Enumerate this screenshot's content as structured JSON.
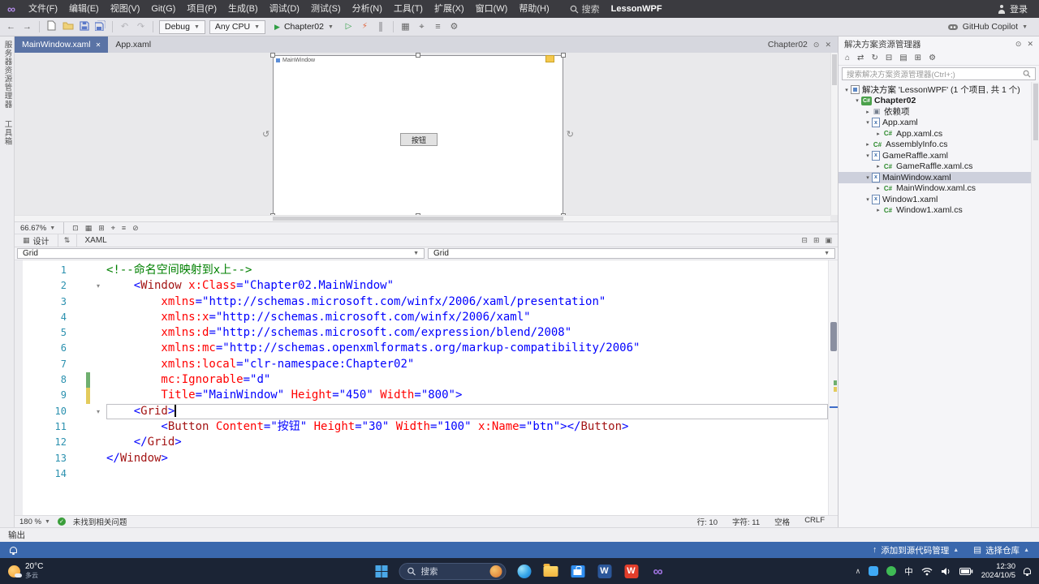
{
  "title_bar": {
    "menus": [
      "文件(F)",
      "编辑(E)",
      "视图(V)",
      "Git(G)",
      "项目(P)",
      "生成(B)",
      "调试(D)",
      "测试(S)",
      "分析(N)",
      "工具(T)",
      "扩展(X)",
      "窗口(W)",
      "帮助(H)"
    ],
    "search_label": "搜索",
    "solution_name": "LessonWPF",
    "sign_in_label": "登录"
  },
  "toolbar": {
    "debug_config": "Debug",
    "platform": "Any CPU",
    "run_target": "Chapter02",
    "copilot_label": "GitHub Copilot"
  },
  "left_rail": {
    "items": [
      "服务器资源管理器",
      "工具箱"
    ]
  },
  "doc_tabs": {
    "tabs": [
      {
        "label": "MainWindow.xaml",
        "active": true,
        "closable": true
      },
      {
        "label": "App.xaml",
        "active": false,
        "closable": false
      }
    ],
    "group_label": "Chapter02"
  },
  "designer": {
    "window_title": "MainWindow",
    "button_label": "按钮",
    "zoom": "66.67%"
  },
  "view_switch": {
    "design_label": "设计",
    "xaml_label": "XAML"
  },
  "nav_bar": {
    "left_dropdown": "Grid",
    "right_dropdown": "Grid"
  },
  "editor": {
    "status": {
      "zoom": "180 %",
      "health": "未找到相关问题",
      "line": "行: 10",
      "column": "字符: 11",
      "spaces": "空格",
      "line_ending": "CRLF"
    },
    "lines": [
      {
        "n": 1,
        "indent": 0,
        "tokens": [
          {
            "c": "c",
            "x": "<!--命名空间映射到x上-->"
          }
        ]
      },
      {
        "n": 2,
        "indent": 4,
        "fold": true,
        "tokens": [
          {
            "c": "d",
            "x": "<"
          },
          {
            "c": "e",
            "x": "Window"
          },
          {
            "c": "p",
            "x": " "
          },
          {
            "c": "a",
            "x": "x:Class"
          },
          {
            "c": "d",
            "x": "="
          },
          {
            "c": "v",
            "x": "\"Chapter02.MainWindow\""
          }
        ]
      },
      {
        "n": 3,
        "indent": 8,
        "tokens": [
          {
            "c": "a",
            "x": "xmlns"
          },
          {
            "c": "d",
            "x": "="
          },
          {
            "c": "v",
            "x": "\"http://schemas.microsoft.com/winfx/2006/xaml/presentation\""
          }
        ]
      },
      {
        "n": 4,
        "indent": 8,
        "tokens": [
          {
            "c": "a",
            "x": "xmlns:x"
          },
          {
            "c": "d",
            "x": "="
          },
          {
            "c": "v",
            "x": "\"http://schemas.microsoft.com/winfx/2006/xaml\""
          }
        ]
      },
      {
        "n": 5,
        "indent": 8,
        "tokens": [
          {
            "c": "a",
            "x": "xmlns:d"
          },
          {
            "c": "d",
            "x": "="
          },
          {
            "c": "v",
            "x": "\"http://schemas.microsoft.com/expression/blend/2008\""
          }
        ]
      },
      {
        "n": 6,
        "indent": 8,
        "tokens": [
          {
            "c": "a",
            "x": "xmlns:mc"
          },
          {
            "c": "d",
            "x": "="
          },
          {
            "c": "v",
            "x": "\"http://schemas.openxmlformats.org/markup-compatibility/2006\""
          }
        ]
      },
      {
        "n": 7,
        "indent": 8,
        "tokens": [
          {
            "c": "a",
            "x": "xmlns:local"
          },
          {
            "c": "d",
            "x": "="
          },
          {
            "c": "v",
            "x": "\"clr-namespace:Chapter02\""
          }
        ]
      },
      {
        "n": 8,
        "indent": 8,
        "track": "green",
        "tokens": [
          {
            "c": "a",
            "x": "mc:Ignorable"
          },
          {
            "c": "d",
            "x": "="
          },
          {
            "c": "v",
            "x": "\"d\""
          }
        ]
      },
      {
        "n": 9,
        "indent": 8,
        "track": "yellow",
        "tokens": [
          {
            "c": "a",
            "x": "Title"
          },
          {
            "c": "d",
            "x": "="
          },
          {
            "c": "v",
            "x": "\"MainWindow\""
          },
          {
            "c": "p",
            "x": " "
          },
          {
            "c": "a",
            "x": "Height"
          },
          {
            "c": "d",
            "x": "="
          },
          {
            "c": "v",
            "x": "\"450\""
          },
          {
            "c": "p",
            "x": " "
          },
          {
            "c": "a",
            "x": "Width"
          },
          {
            "c": "d",
            "x": "="
          },
          {
            "c": "v",
            "x": "\"800\""
          },
          {
            "c": "d",
            "x": ">"
          }
        ]
      },
      {
        "n": 10,
        "indent": 4,
        "fold": true,
        "current": true,
        "caret": true,
        "tokens": [
          {
            "c": "d",
            "x": "<"
          },
          {
            "c": "e",
            "x": "Grid"
          },
          {
            "c": "d",
            "x": ">"
          }
        ]
      },
      {
        "n": 11,
        "indent": 8,
        "tokens": [
          {
            "c": "d",
            "x": "<"
          },
          {
            "c": "e",
            "x": "Button"
          },
          {
            "c": "p",
            "x": " "
          },
          {
            "c": "a",
            "x": "Content"
          },
          {
            "c": "d",
            "x": "="
          },
          {
            "c": "v",
            "x": "\"按钮\""
          },
          {
            "c": "p",
            "x": " "
          },
          {
            "c": "a",
            "x": "Height"
          },
          {
            "c": "d",
            "x": "="
          },
          {
            "c": "v",
            "x": "\"30\""
          },
          {
            "c": "p",
            "x": " "
          },
          {
            "c": "a",
            "x": "Width"
          },
          {
            "c": "d",
            "x": "="
          },
          {
            "c": "v",
            "x": "\"100\""
          },
          {
            "c": "p",
            "x": " "
          },
          {
            "c": "a",
            "x": "x:Name"
          },
          {
            "c": "d",
            "x": "="
          },
          {
            "c": "v",
            "x": "\"btn\""
          },
          {
            "c": "d",
            "x": "></"
          },
          {
            "c": "e",
            "x": "Button"
          },
          {
            "c": "d",
            "x": ">"
          }
        ]
      },
      {
        "n": 12,
        "indent": 4,
        "tokens": [
          {
            "c": "d",
            "x": "</"
          },
          {
            "c": "e",
            "x": "Grid"
          },
          {
            "c": "d",
            "x": ">"
          }
        ]
      },
      {
        "n": 13,
        "indent": 0,
        "tokens": [
          {
            "c": "d",
            "x": "</"
          },
          {
            "c": "e",
            "x": "Window"
          },
          {
            "c": "d",
            "x": ">"
          }
        ]
      },
      {
        "n": 14,
        "indent": 0,
        "tokens": []
      }
    ]
  },
  "solution_explorer": {
    "title": "解决方案资源管理器",
    "search_placeholder": "搜索解决方案资源管理器(Ctrl+;)",
    "tree": [
      {
        "indent": 0,
        "expander": "open",
        "icon": "solution",
        "label": "解决方案 'LessonWPF' (1 个项目, 共 1 个)"
      },
      {
        "indent": 1,
        "expander": "open",
        "icon": "project",
        "label": "Chapter02",
        "bold": true
      },
      {
        "indent": 2,
        "expander": "closed",
        "icon": "dependencies",
        "label": "依赖项"
      },
      {
        "indent": 2,
        "expander": "open",
        "icon": "xaml",
        "label": "App.xaml"
      },
      {
        "indent": 3,
        "expander": "closed",
        "icon": "cs",
        "label": "App.xaml.cs"
      },
      {
        "indent": 2,
        "expander": "closed",
        "icon": "cs",
        "label": "AssemblyInfo.cs"
      },
      {
        "indent": 2,
        "expander": "open",
        "icon": "xaml",
        "label": "GameRaffle.xaml"
      },
      {
        "indent": 3,
        "expander": "closed",
        "icon": "cs",
        "label": "GameRaffle.xaml.cs"
      },
      {
        "indent": 2,
        "expander": "open",
        "icon": "xaml",
        "label": "MainWindow.xaml",
        "selected": true
      },
      {
        "indent": 3,
        "expander": "closed",
        "icon": "cs",
        "label": "MainWindow.xaml.cs"
      },
      {
        "indent": 2,
        "expander": "open",
        "icon": "xaml",
        "label": "Window1.xaml"
      },
      {
        "indent": 3,
        "expander": "closed",
        "icon": "cs",
        "label": "Window1.xaml.cs"
      }
    ]
  },
  "output_panel": {
    "label": "输出"
  },
  "status_bar": {
    "add_to_source_control": "添加到源代码管理",
    "select_repository": "选择仓库"
  },
  "taskbar": {
    "weather_temp": "20°C",
    "weather_desc": "多云",
    "search_label": "搜索",
    "ime": "中",
    "time": "12:30",
    "date": "2024/10/5",
    "apps": [
      {
        "id": "edge",
        "name": "microsoft-edge"
      },
      {
        "id": "explorer",
        "name": "file-explorer"
      },
      {
        "id": "store",
        "name": "microsoft-store"
      },
      {
        "id": "word",
        "name": "word"
      },
      {
        "id": "wps",
        "name": "wps-office"
      },
      {
        "id": "vs",
        "name": "visual-studio"
      }
    ]
  },
  "colors": {
    "active_tab": "#5A73A5",
    "status_bar": "#3A68AD",
    "xml_element": "#A31515",
    "xml_attribute": "#FF0000",
    "xml_value": "#0000FF",
    "xml_comment": "#008000"
  }
}
